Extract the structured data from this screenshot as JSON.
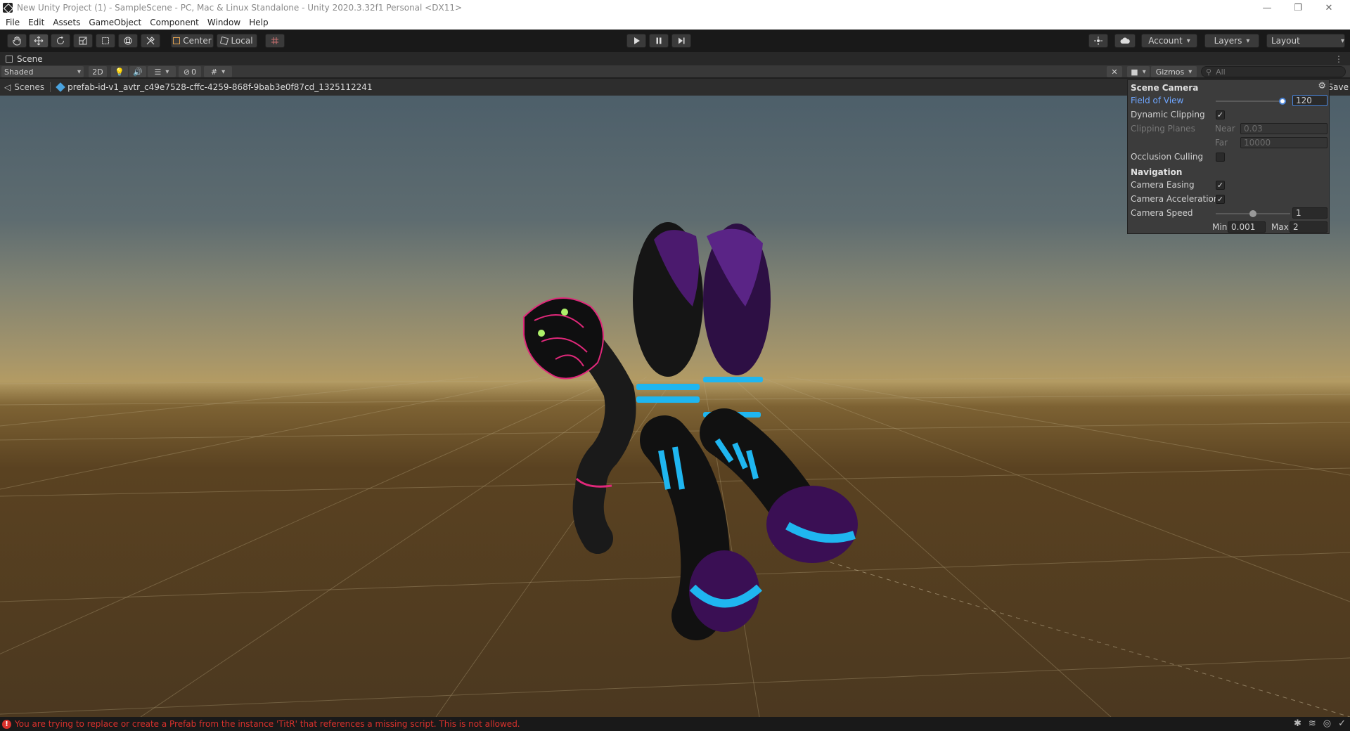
{
  "window": {
    "title": "New Unity Project (1) - SampleScene - PC, Mac & Linux Standalone - Unity 2020.3.32f1 Personal <DX11>",
    "minimize": "—",
    "maximize": "❐",
    "close": "✕"
  },
  "menu": [
    "File",
    "Edit",
    "Assets",
    "GameObject",
    "Component",
    "Window",
    "Help"
  ],
  "toolbar": {
    "pivot_label": "Center",
    "space_label": "Local",
    "account_label": "Account",
    "layers_label": "Layers",
    "layout_label": "Layout"
  },
  "scene_tab": {
    "label": "Scene"
  },
  "scene_toolbar": {
    "draw_mode": "Shaded",
    "mode_2d": "2D",
    "hidden_count": "0",
    "gizmos_label": "Gizmos",
    "search_placeholder": "All"
  },
  "breadcrumb": {
    "scenes_label": "Scenes",
    "prefab_label": "prefab-id-v1_avtr_c49e7528-cffc-4259-868f-9bab3e0f87cd_1325112241",
    "save_label": "Save"
  },
  "scene_camera": {
    "header": "Scene Camera",
    "fov_label": "Field of View",
    "fov_value": "120",
    "fov_fraction": 0.96,
    "dynamic_clipping_label": "Dynamic Clipping",
    "dynamic_clipping_checked": true,
    "clipping_planes_label": "Clipping Planes",
    "near_label": "Near",
    "near_value": "0.03",
    "far_label": "Far",
    "far_value": "10000",
    "occlusion_label": "Occlusion Culling",
    "occlusion_checked": false,
    "navigation_header": "Navigation",
    "easing_label": "Camera Easing",
    "easing_checked": true,
    "acceleration_label": "Camera Acceleration",
    "acceleration_checked": true,
    "speed_label": "Camera Speed",
    "speed_value": "1",
    "speed_fraction": 0.5,
    "min_label": "Min",
    "min_value": "0.001",
    "max_label": "Max",
    "max_value": "2"
  },
  "status": {
    "error_message": "You are trying to replace or create a Prefab from the instance 'TitR' that references a missing script. This is not allowed."
  },
  "colors": {
    "error": "#d8312c",
    "accent_blue": "#6fa6ff",
    "model_cyan": "#1fb6f0",
    "model_purple": "#4b1a6e",
    "model_pink": "#e0287a"
  }
}
